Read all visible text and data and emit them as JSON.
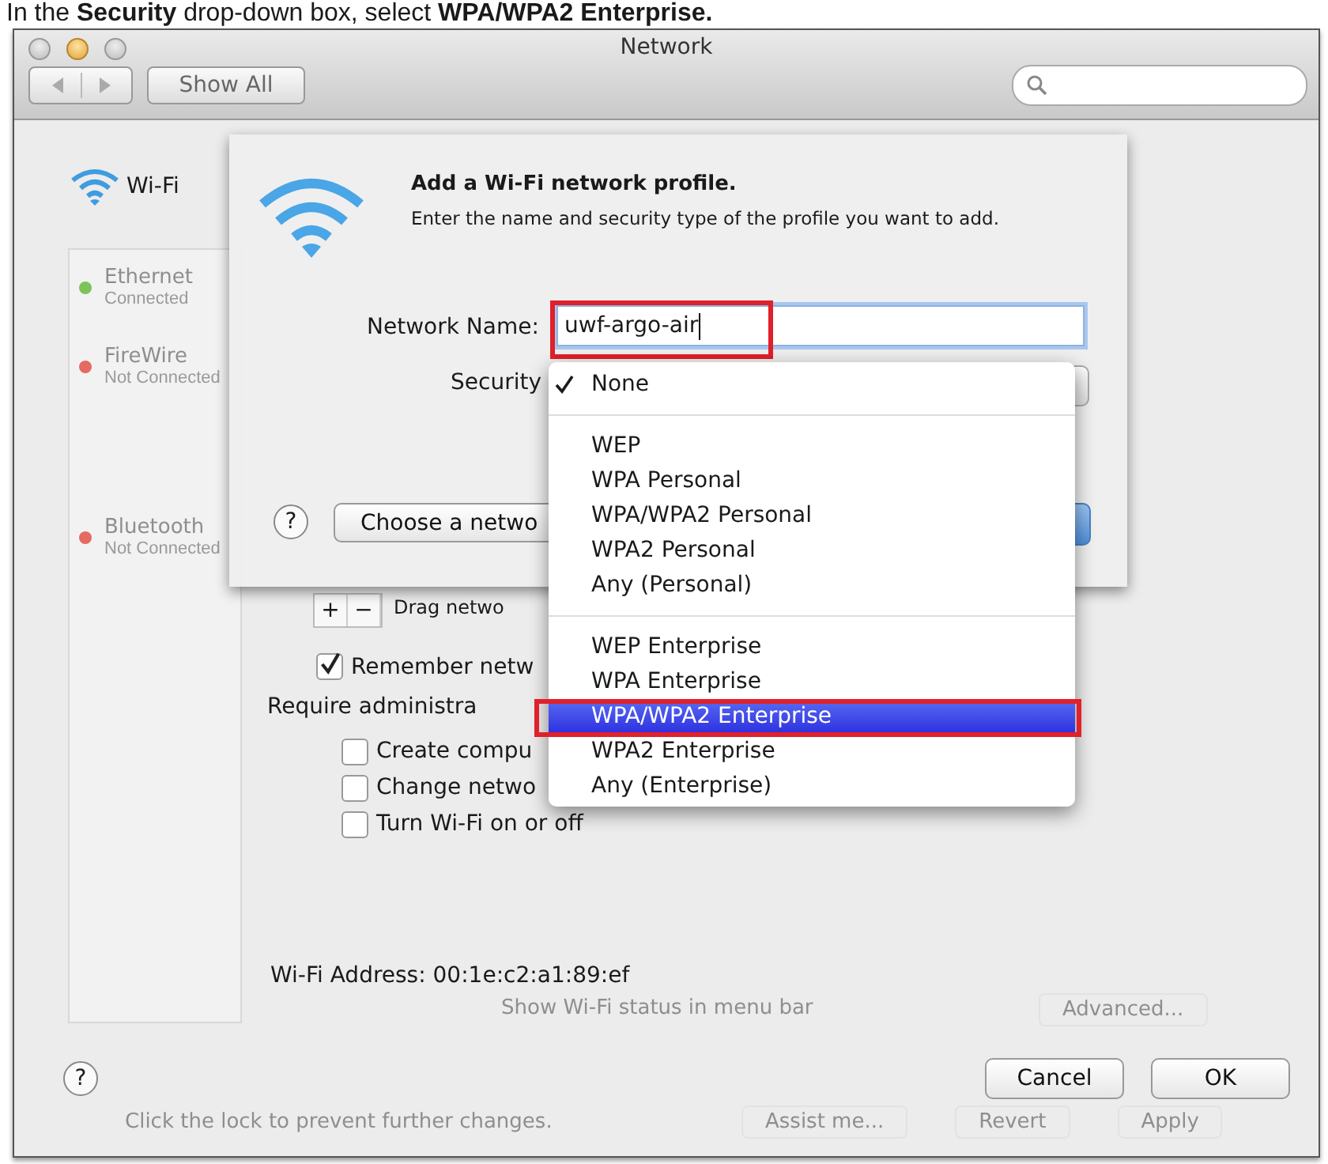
{
  "caption": "In the **Security** drop-down box, select **WPA/WPA2 Enterprise.**",
  "window": {
    "title": "Network"
  },
  "toolbar": {
    "show_all": "Show All"
  },
  "sidebar": {
    "header": "Wi-Fi",
    "items": [
      {
        "name": "Ethernet",
        "status": "Connected",
        "color": "#7cc35a"
      },
      {
        "name": "FireWire",
        "status": "Not Connected",
        "color": "#e46a62"
      },
      {
        "name": "Bluetooth",
        "status": "Not Connected",
        "color": "#e46a62"
      }
    ]
  },
  "advanced": {
    "plus_minus": [
      "+",
      "−"
    ],
    "drag_hint": "Drag netwo",
    "remember": {
      "label": "Remember netw",
      "checked": true
    },
    "require_label": "Require administra",
    "options": [
      {
        "label": "Create compu",
        "checked": false
      },
      {
        "label": "Change netwo",
        "checked": false
      },
      {
        "label": "Turn Wi-Fi on or off",
        "checked": false
      }
    ],
    "address": "Wi-Fi Address: 00:1e:c2:a1:89:ef",
    "show_status": "Show Wi-Fi status in menu bar",
    "advanced_button": "Advanced...",
    "help": "?",
    "buttons": [
      "Cancel",
      "OK"
    ]
  },
  "footer": {
    "lock_text": "Click the lock to prevent further changes.",
    "buttons": [
      "Assist me...",
      "Revert",
      "Apply"
    ]
  },
  "sheet": {
    "title": "Add a Wi-Fi network profile.",
    "description": "Enter the name and security type of the profile you want to add.",
    "name_label": "Network Name:",
    "name_value": "uwf-argo-air",
    "security_label": "Security",
    "help": "?",
    "choose_button": "Choose a netwo"
  },
  "menu": {
    "groups": [
      [
        {
          "label": "None",
          "checked": true,
          "selected": false
        }
      ],
      [
        {
          "label": "WEP",
          "checked": false,
          "selected": false
        },
        {
          "label": "WPA Personal",
          "checked": false,
          "selected": false
        },
        {
          "label": "WPA/WPA2 Personal",
          "checked": false,
          "selected": false
        },
        {
          "label": "WPA2 Personal",
          "checked": false,
          "selected": false
        },
        {
          "label": "Any (Personal)",
          "checked": false,
          "selected": false
        }
      ],
      [
        {
          "label": "WEP Enterprise",
          "checked": false,
          "selected": false
        },
        {
          "label": "WPA Enterprise",
          "checked": false,
          "selected": false
        },
        {
          "label": "WPA/WPA2 Enterprise",
          "checked": false,
          "selected": true
        },
        {
          "label": "WPA2 Enterprise",
          "checked": false,
          "selected": false
        },
        {
          "label": "Any (Enterprise)",
          "checked": false,
          "selected": false
        }
      ]
    ]
  }
}
